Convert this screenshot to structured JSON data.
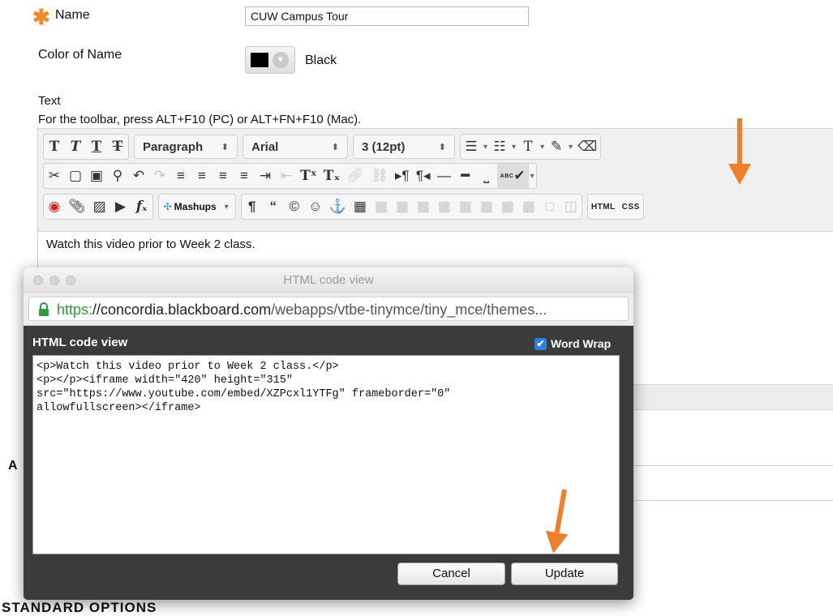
{
  "form": {
    "name_label": "Name",
    "name_value": "CUW Campus Tour",
    "color_label": "Color of Name",
    "color_value": "Black",
    "text_label": "Text",
    "toolbar_hint": "For the toolbar, press ALT+F10 (PC) or ALT+FN+F10 (Mac)."
  },
  "toolbar": {
    "paragraph": "Paragraph",
    "font": "Arial",
    "size": "3 (12pt)",
    "mashups": "Mashups",
    "html_button": "HTML",
    "css_button": "CSS",
    "spell_label": "ABC"
  },
  "editor": {
    "content": "Watch this video prior to Week 2 class."
  },
  "page": {
    "section_letter": "A",
    "standard_options": "STANDARD OPTIONS"
  },
  "modal": {
    "window_title": "HTML code view",
    "url_scheme": "https:",
    "url_domain": "//concordia.blackboard.com",
    "url_path": "/webapps/vtbe-tinymce/tiny_mce/themes...",
    "panel_title": "HTML code view",
    "word_wrap_label": "Word Wrap",
    "code": "<p>Watch this video prior to Week 2 class.</p>\n<p></p><iframe width=\"420\" height=\"315\"\nsrc=\"https://www.youtube.com/embed/XZPcxl1YTFg\" frameborder=\"0\"\nallowfullscreen></iframe>",
    "cancel_label": "Cancel",
    "update_label": "Update"
  },
  "colors": {
    "accent_orange": "#f07f2b",
    "required_star": "#f28a2a",
    "checkbox_blue": "#2f7ee0",
    "url_green": "#2f9b3a"
  }
}
